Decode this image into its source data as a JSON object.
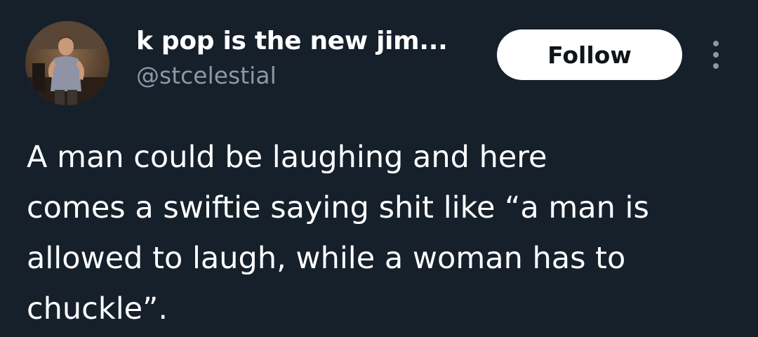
{
  "author": {
    "display_name": "k pop is the new jim...",
    "handle": "@stcelestial",
    "avatar_icon": "profile-photo"
  },
  "actions": {
    "follow_label": "Follow",
    "more_icon": "more-options-icon"
  },
  "tweet": {
    "text": "A man could be laughing and here\ncomes a swiftie saying shit like “a man is\nallowed to laugh, while a woman has to\nchuckle”."
  },
  "colors": {
    "background": "#15202b",
    "text_primary": "#ffffff",
    "text_secondary": "#8b98a5",
    "button_bg": "#ffffff",
    "button_text": "#0f1419"
  }
}
